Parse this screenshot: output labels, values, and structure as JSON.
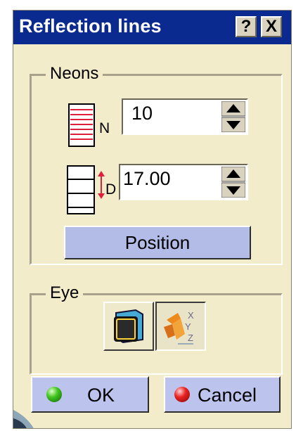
{
  "window": {
    "title": "Reflection lines",
    "help_label": "?",
    "close_label": "X"
  },
  "neons": {
    "legend": "Neons",
    "number_label": "N",
    "number_value": "10",
    "distance_label": "D",
    "distance_value": "17.00",
    "position_label": "Position"
  },
  "eye": {
    "legend": "Eye"
  },
  "footer": {
    "ok_label": "OK",
    "cancel_label": "Cancel"
  },
  "colors": {
    "title_bg": "#0b2a8f",
    "dialog_bg": "#f2eccb",
    "button_bg": "#b2bce6"
  }
}
